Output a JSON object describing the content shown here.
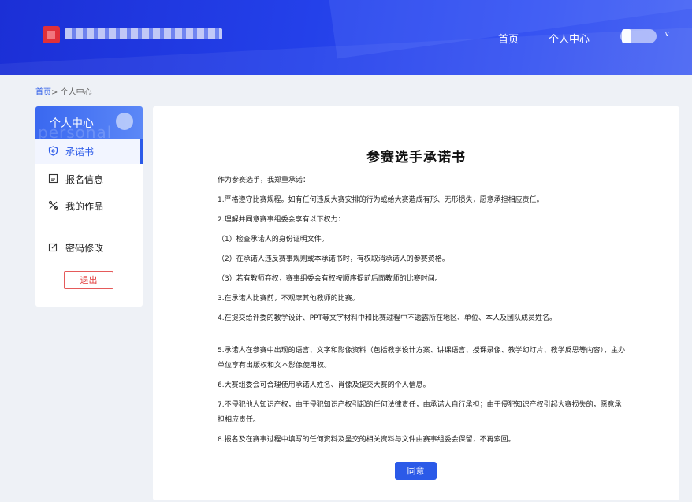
{
  "header": {
    "nav_home": "首页",
    "nav_center": "个人中心"
  },
  "breadcrumb": {
    "home": "首页",
    "separator": ">",
    "current": "个人中心"
  },
  "sidebar": {
    "title": "个人中心",
    "watermark": "personal",
    "items": [
      {
        "label": "承诺书",
        "icon": "shield-icon",
        "active": true
      },
      {
        "label": "报名信息",
        "icon": "form-icon"
      },
      {
        "label": "我的作品",
        "icon": "works-icon"
      },
      {
        "label": "密码修改",
        "icon": "edit-icon"
      }
    ],
    "logout_label": "退出"
  },
  "document": {
    "title": "参赛选手承诺书",
    "paragraphs": [
      "作为参赛选手，我郑重承诺：",
      "1.严格遵守比赛规程。如有任何违反大赛安排的行为或给大赛造成有形、无形损失，愿意承担相应责任。",
      "2.理解并同意赛事组委会享有以下权力：",
      "（1）检查承诺人的身份证明文件。",
      "（2）在承诺人违反赛事规则或本承诺书时，有权取消承诺人的参赛资格。",
      "（3）若有教师弃权，赛事组委会有权按顺序提前后面教师的比赛时间。",
      "3.在承诺人比赛前，不观摩其他教师的比赛。",
      "4.在提交给评委的教学设计、PPT等文字材料中和比赛过程中不透露所在地区、单位、本人及团队成员姓名。",
      "5.承诺人在参赛中出现的语言、文字和影像资料（包括教学设计方案、讲课语言、授课录像、教学幻灯片、教学反思等内容），主办单位享有出版权和文本影像使用权。",
      "6.大赛组委会可合理使用承诺人姓名、肖像及提交大赛的个人信息。",
      "7.不侵犯他人知识产权，由于侵犯知识产权引起的任何法律责任，由承诺人自行承担；由于侵犯知识产权引起大赛损失的，愿意承担相应责任。",
      "8.报名及在赛事过程中填写的任何资料及呈交的相关资料与文件由赛事组委会保留，不再索回。"
    ],
    "agree_label": "同意"
  },
  "colors": {
    "accent": "#2b5ae8",
    "header": "#2441ea",
    "danger": "#e23b3b"
  }
}
